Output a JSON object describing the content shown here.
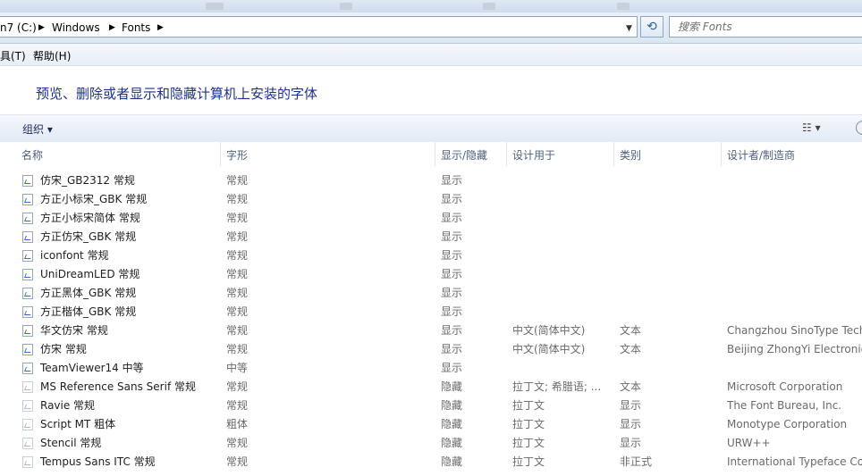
{
  "address": {
    "crumbs": [
      "n7 (C:)",
      "Windows",
      "Fonts"
    ],
    "search_placeholder": "搜索 Fonts"
  },
  "menu": {
    "tools": "具(T)",
    "help": "帮助(H)"
  },
  "title": "预览、删除或者显示和隐藏计算机上安装的字体",
  "toolbar": {
    "organize": "组织 ▾",
    "view_icon": "view-options-icon"
  },
  "columns": {
    "name": "名称",
    "style": "字形",
    "show_hide": "显示/隐藏",
    "designed_for": "设计用于",
    "category": "类别",
    "designer": "设计者/制造商"
  },
  "fonts": [
    {
      "name": "仿宋_GB2312 常规",
      "style": "常规",
      "show": "显示",
      "designed_for": "",
      "category": "",
      "designer": ""
    },
    {
      "name": "方正小标宋_GBK 常规",
      "style": "常规",
      "show": "显示",
      "designed_for": "",
      "category": "",
      "designer": ""
    },
    {
      "name": "方正小标宋简体 常规",
      "style": "常规",
      "show": "显示",
      "designed_for": "",
      "category": "",
      "designer": ""
    },
    {
      "name": "方正仿宋_GBK 常规",
      "style": "常规",
      "show": "显示",
      "designed_for": "",
      "category": "",
      "designer": ""
    },
    {
      "name": "iconfont 常规",
      "style": "常规",
      "show": "显示",
      "designed_for": "",
      "category": "",
      "designer": ""
    },
    {
      "name": "UniDreamLED 常规",
      "style": "常规",
      "show": "显示",
      "designed_for": "",
      "category": "",
      "designer": ""
    },
    {
      "name": "方正黑体_GBK 常规",
      "style": "常规",
      "show": "显示",
      "designed_for": "",
      "category": "",
      "designer": ""
    },
    {
      "name": "方正楷体_GBK 常规",
      "style": "常规",
      "show": "显示",
      "designed_for": "",
      "category": "",
      "designer": ""
    },
    {
      "name": "华文仿宋 常规",
      "style": "常规",
      "show": "显示",
      "designed_for": "中文(简体中文)",
      "category": "文本",
      "designer": "Changzhou SinoType Tech"
    },
    {
      "name": "仿宋 常规",
      "style": "常规",
      "show": "显示",
      "designed_for": "中文(简体中文)",
      "category": "文本",
      "designer": "Beijing ZhongYi Electronic"
    },
    {
      "name": "TeamViewer14 中等",
      "style": "中等",
      "show": "显示",
      "designed_for": "",
      "category": "",
      "designer": ""
    },
    {
      "name": "MS Reference Sans Serif 常规",
      "style": "常规",
      "show": "隐藏",
      "designed_for": "拉丁文; 希腊语; ...",
      "category": "文本",
      "designer": "Microsoft Corporation"
    },
    {
      "name": "Ravie 常规",
      "style": "常规",
      "show": "隐藏",
      "designed_for": "拉丁文",
      "category": "显示",
      "designer": "The Font Bureau, Inc."
    },
    {
      "name": "Script MT 粗体",
      "style": "粗体",
      "show": "隐藏",
      "designed_for": "拉丁文",
      "category": "显示",
      "designer": "Monotype Corporation"
    },
    {
      "name": "Stencil 常规",
      "style": "常规",
      "show": "隐藏",
      "designed_for": "拉丁文",
      "category": "显示",
      "designer": "URW++"
    },
    {
      "name": "Tempus Sans ITC 常规",
      "style": "常规",
      "show": "隐藏",
      "designed_for": "拉丁文",
      "category": "非正式",
      "designer": "International Typeface Cor"
    }
  ]
}
